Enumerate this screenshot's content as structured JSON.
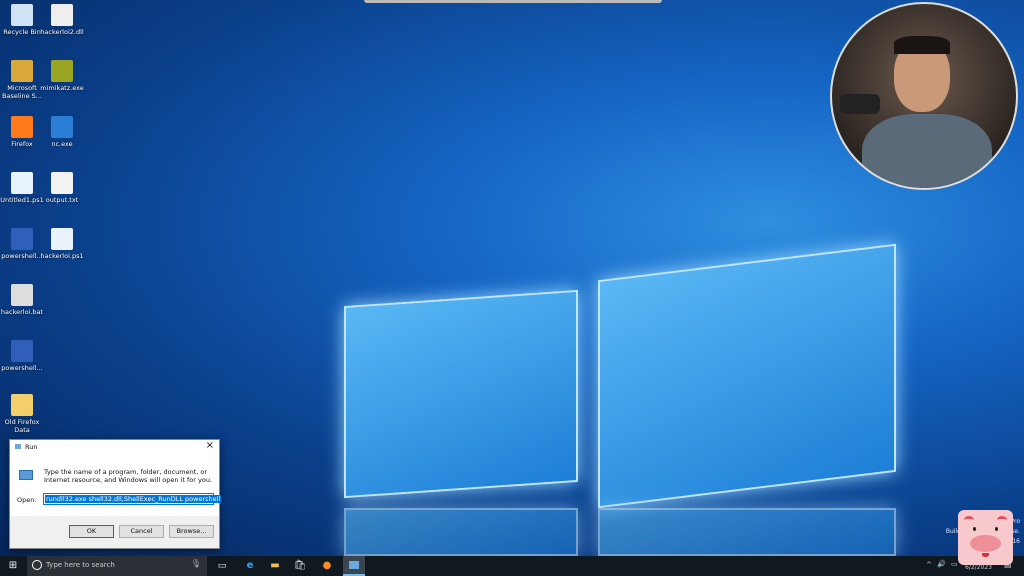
{
  "desktop_icons": [
    {
      "label": "Recycle Bin",
      "icon": "recycle-bin-icon"
    },
    {
      "label": "hackerloi2.dll",
      "icon": "dll-file-icon"
    },
    {
      "label": "Microsoft Baseline S...",
      "icon": "security-baseline-icon"
    },
    {
      "label": "mimikatz.exe",
      "icon": "kiwi-icon"
    },
    {
      "label": "Firefox",
      "icon": "firefox-icon"
    },
    {
      "label": "nc.exe",
      "icon": "exe-window-icon"
    },
    {
      "label": "Untitled1.ps1",
      "icon": "ps1-file-icon"
    },
    {
      "label": "output.txt",
      "icon": "text-file-icon"
    },
    {
      "label": "powershell...",
      "icon": "powershell-icon"
    },
    {
      "label": "hackerloi.ps1",
      "icon": "ps1-file-icon"
    },
    {
      "label": "hackerloi.bat",
      "icon": "bat-file-icon"
    },
    {
      "label": "powershell...",
      "icon": "powershell-icon"
    },
    {
      "label": "Old Firefox Data",
      "icon": "folder-icon"
    }
  ],
  "run_dialog": {
    "title": "Run",
    "description": "Type the name of a program, folder, document, or Internet resource, and Windows will open it for you.",
    "open_label": "Open:",
    "open_value": "rundll32.exe shell32.dll,ShellExec_RunDLL powershell",
    "ok": "OK",
    "cancel": "Cancel",
    "browse": "Browse..."
  },
  "taskbar": {
    "search_placeholder": "Type here to search",
    "date": "6/2/2023",
    "watermark_lines": [
      "Pro",
      "Build 14393.rs1_release.",
      "1816"
    ]
  },
  "colors": {
    "accent": "#0078d7",
    "taskbar": "#101820"
  }
}
